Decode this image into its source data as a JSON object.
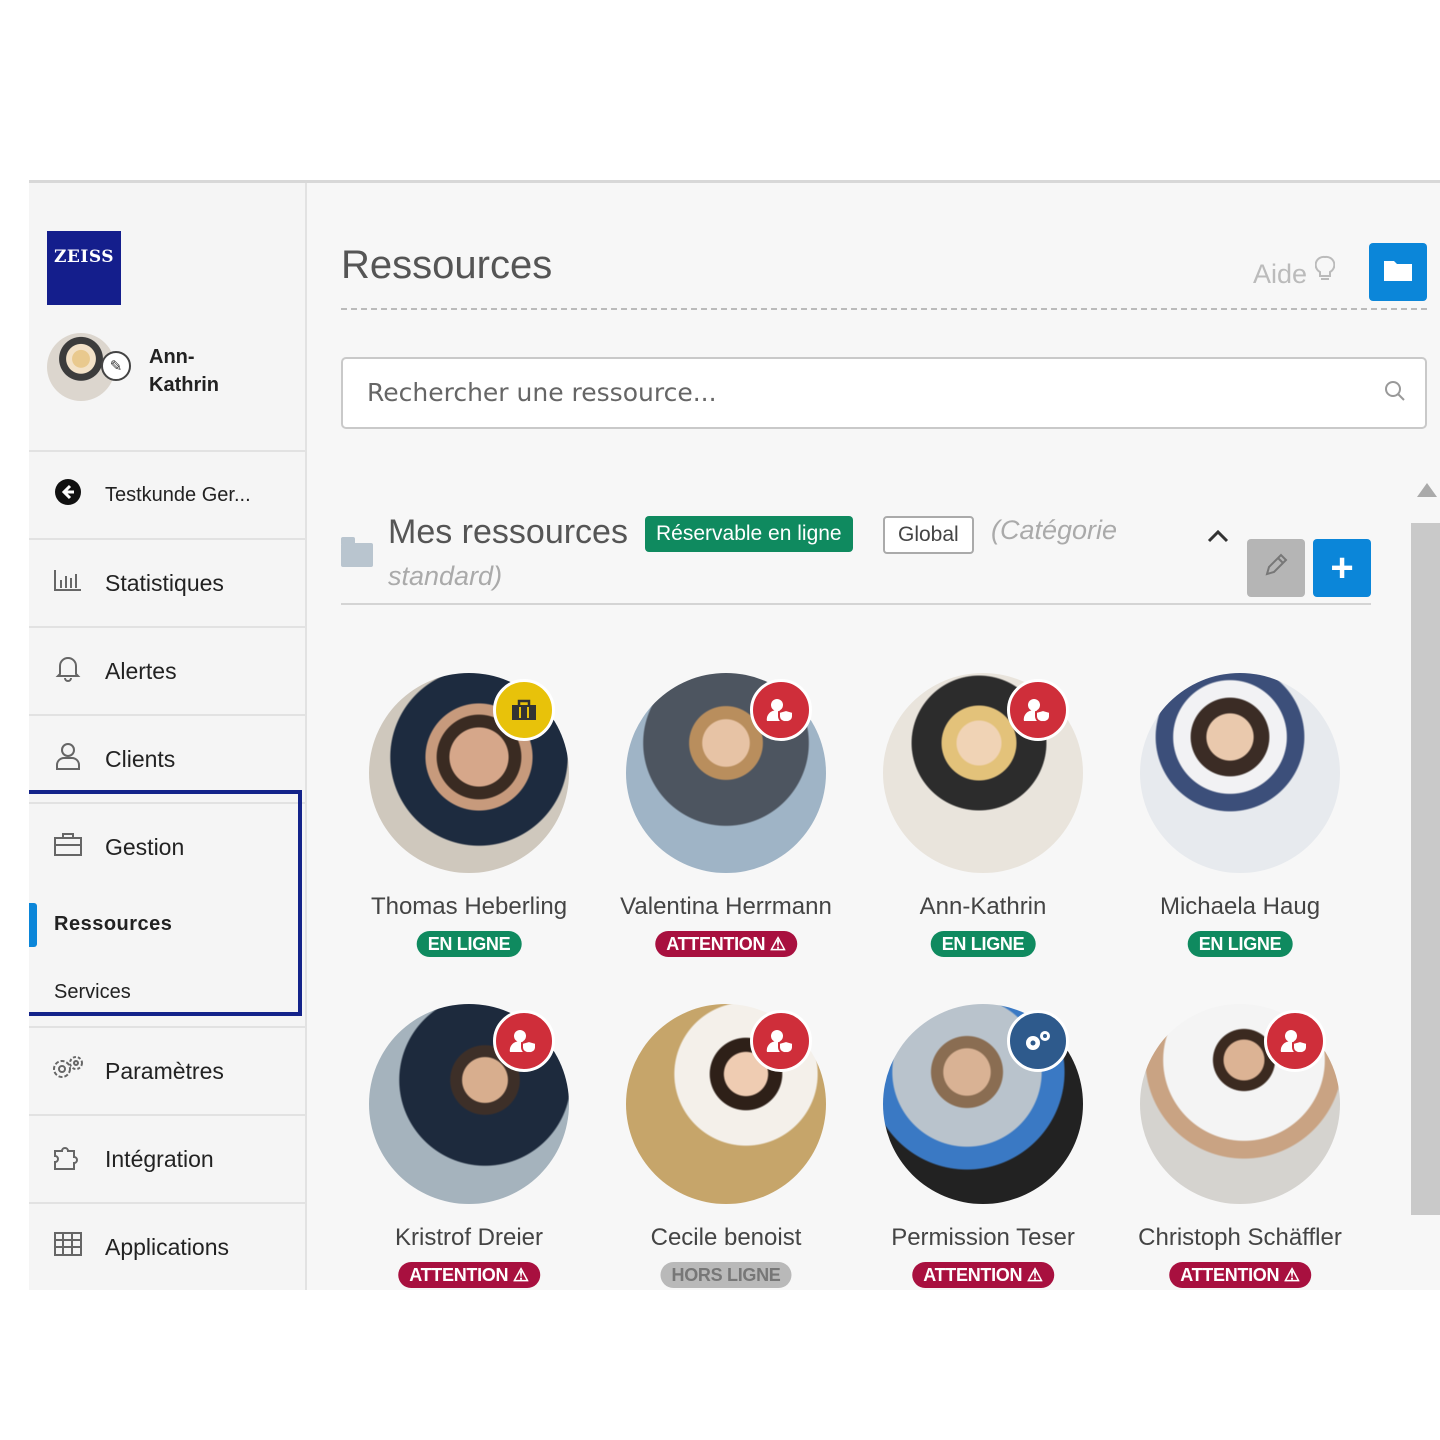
{
  "brand": {
    "logo_text": "ZEISS"
  },
  "user": {
    "name": "Ann-\nKathrin"
  },
  "sidebar": {
    "items": [
      {
        "label": "Testkunde Ger...",
        "icon": "back-circle-icon"
      },
      {
        "label": "Statistiques",
        "icon": "bar-chart-icon"
      },
      {
        "label": "Alertes",
        "icon": "bell-icon"
      },
      {
        "label": "Clients",
        "icon": "user-icon"
      },
      {
        "label": "Gestion",
        "icon": "briefcase-icon"
      },
      {
        "label": "Paramètres",
        "icon": "gears-icon"
      },
      {
        "label": "Intégration",
        "icon": "puzzle-icon"
      },
      {
        "label": "Applications",
        "icon": "grid-icon"
      }
    ],
    "sub_items": [
      {
        "label": "Ressources",
        "active": true
      },
      {
        "label": "Services",
        "active": false
      }
    ]
  },
  "header": {
    "title": "Ressources",
    "help_label": "Aide"
  },
  "search": {
    "placeholder": "Rechercher une ressource..."
  },
  "group": {
    "title": "Mes ressources",
    "tag_online": "Réservable en ligne",
    "tag_scope": "Global",
    "category_line1": "(Catégorie",
    "category_line2": "standard)"
  },
  "resources": [
    {
      "name": "Thomas Heberling",
      "status": "EN LIGNE",
      "status_type": "online",
      "badge": "briefcase-icon",
      "badge_color": "#e8c20a"
    },
    {
      "name": "Valentina Herrmann",
      "status": "ATTENTION",
      "status_type": "attention",
      "badge": "user-shield-icon",
      "badge_color": "#cf2e3a"
    },
    {
      "name": "Ann-Kathrin",
      "status": "EN LIGNE",
      "status_type": "online",
      "badge": "user-shield-icon",
      "badge_color": "#cf2e3a"
    },
    {
      "name": "Michaela Haug",
      "status": "EN LIGNE",
      "status_type": "online",
      "badge": "",
      "badge_color": ""
    },
    {
      "name": "Kristrof Dreier",
      "status": "ATTENTION",
      "status_type": "attention",
      "badge": "user-shield-icon",
      "badge_color": "#cf2e3a"
    },
    {
      "name": "Cecile benoist",
      "status": "HORS LIGNE",
      "status_type": "offline",
      "badge": "user-shield-icon",
      "badge_color": "#cf2e3a"
    },
    {
      "name": "Permission Teser",
      "status": "ATTENTION",
      "status_type": "attention",
      "badge": "gears-icon",
      "badge_color": "#2e5a8c"
    },
    {
      "name": "Christoph Schäffler",
      "status": "ATTENTION",
      "status_type": "attention",
      "badge": "user-shield-icon",
      "badge_color": "#cf2e3a"
    }
  ],
  "colors": {
    "accent": "#0b86d9",
    "online": "#0f8a5f",
    "attention": "#a8103f",
    "offline": "#b9b9b9",
    "highlight_box": "#14238a"
  }
}
